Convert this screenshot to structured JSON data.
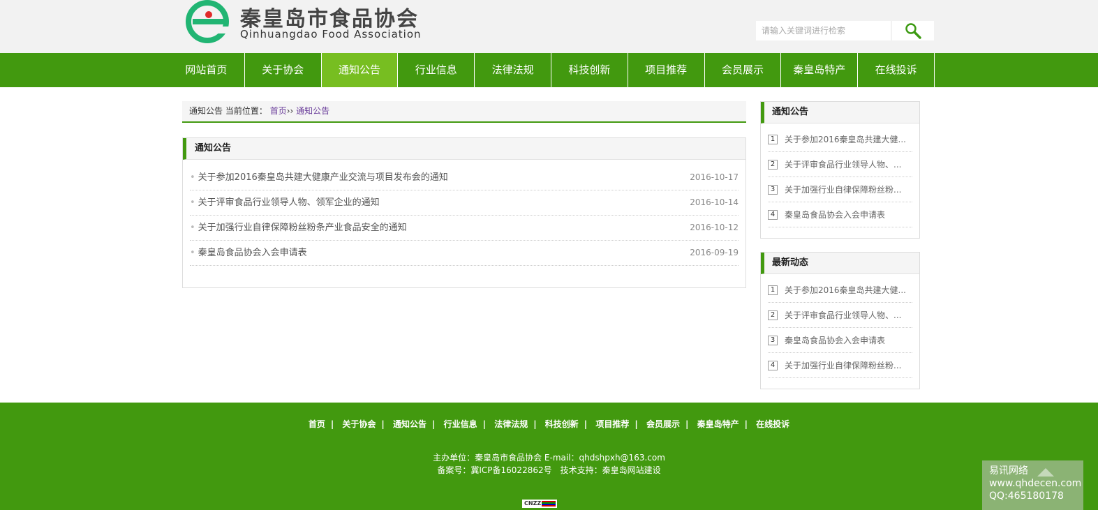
{
  "header": {
    "logo_cn": "秦皇岛市食品协会",
    "logo_en": "Qinhuangdao Food Association",
    "search_placeholder": "请输入关键词进行检索"
  },
  "nav": [
    {
      "label": "网站首页",
      "active": false
    },
    {
      "label": "关于协会",
      "active": false
    },
    {
      "label": "通知公告",
      "active": true
    },
    {
      "label": "行业信息",
      "active": false
    },
    {
      "label": "法律法规",
      "active": false
    },
    {
      "label": "科技创新",
      "active": false
    },
    {
      "label": "项目推荐",
      "active": false
    },
    {
      "label": "会员展示",
      "active": false
    },
    {
      "label": "秦皇岛特产",
      "active": false
    },
    {
      "label": "在线投诉",
      "active": false
    }
  ],
  "breadcrumb": {
    "section": "通知公告",
    "prefix": "当前位置：",
    "home": "首页",
    "sep": "››",
    "current": "通知公告"
  },
  "main": {
    "title": "通知公告",
    "items": [
      {
        "title": "关于参加2016秦皇岛共建大健康产业交流与项目发布会的通知",
        "date": "2016-10-17"
      },
      {
        "title": "关于评审食品行业领导人物、领军企业的通知",
        "date": "2016-10-14"
      },
      {
        "title": "关于加强行业自律保障粉丝粉条产业食品安全的通知",
        "date": "2016-10-12"
      },
      {
        "title": "秦皇岛食品协会入会申请表",
        "date": "2016-09-19"
      }
    ]
  },
  "side_notice": {
    "title": "通知公告",
    "items": [
      {
        "num": "1",
        "title": "关于参加2016秦皇岛共建大健..."
      },
      {
        "num": "2",
        "title": "关于评审食品行业领导人物、..."
      },
      {
        "num": "3",
        "title": "关于加强行业自律保障粉丝粉..."
      },
      {
        "num": "4",
        "title": "秦皇岛食品协会入会申请表"
      }
    ]
  },
  "side_news": {
    "title": "最新动态",
    "items": [
      {
        "num": "1",
        "title": "关于参加2016秦皇岛共建大健..."
      },
      {
        "num": "2",
        "title": "关于评审食品行业领导人物、..."
      },
      {
        "num": "3",
        "title": "秦皇岛食品协会入会申请表"
      },
      {
        "num": "4",
        "title": "关于加强行业自律保障粉丝粉..."
      }
    ]
  },
  "footer": {
    "links": [
      "首页",
      "关于协会",
      "通知公告",
      "行业信息",
      "法律法规",
      "科技创新",
      "项目推荐",
      "会员展示",
      "秦皇岛特产",
      "在线投诉"
    ],
    "sep": "|",
    "line1": "主办单位：秦皇岛市食品协会 E-mail：qhdshpxh@163.com",
    "line2": "备案号：冀ICP备16022862号　技术支持：秦皇岛网站建设",
    "badge": "CNZZ"
  },
  "float_box": {
    "line1": "易讯网络",
    "line2": "www.qhdecen.com",
    "line3": "QQ:465180178"
  },
  "colors": {
    "brand_green": "#42990f",
    "active_green": "#77be21",
    "logo_teal": "#21b573"
  }
}
